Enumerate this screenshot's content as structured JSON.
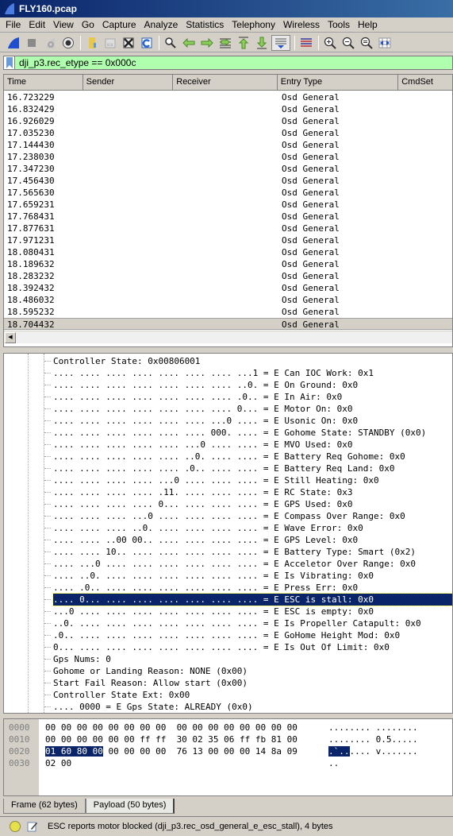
{
  "window": {
    "title": "FLY160.pcap"
  },
  "menu": [
    "File",
    "Edit",
    "View",
    "Go",
    "Capture",
    "Analyze",
    "Statistics",
    "Telephony",
    "Wireless",
    "Tools",
    "Help"
  ],
  "toolbar": {
    "icons": [
      "start-capture-icon",
      "stop-capture-icon",
      "restart-capture-icon",
      "capture-options-icon",
      "open-file-icon",
      "save-file-icon",
      "close-file-icon",
      "reload-file-icon",
      "find-packet-icon",
      "go-back-icon",
      "go-forward-icon",
      "go-to-packet-icon",
      "go-first-icon",
      "go-last-icon",
      "autoscroll-icon",
      "colorize-icon",
      "zoom-in-icon",
      "zoom-out-icon",
      "normal-size-icon",
      "resize-columns-icon"
    ]
  },
  "filter": {
    "value": "dji_p3.rec_etype == 0x000c",
    "placeholder": ""
  },
  "packet_list": {
    "columns": [
      "Time",
      "Sender",
      "Receiver",
      "Entry Type",
      "CmdSet"
    ],
    "rows": [
      {
        "time": "16.723229",
        "sender": "",
        "receiver": "",
        "entry_type": "Osd General",
        "cmdset": ""
      },
      {
        "time": "16.832429",
        "sender": "",
        "receiver": "",
        "entry_type": "Osd General",
        "cmdset": ""
      },
      {
        "time": "16.926029",
        "sender": "",
        "receiver": "",
        "entry_type": "Osd General",
        "cmdset": ""
      },
      {
        "time": "17.035230",
        "sender": "",
        "receiver": "",
        "entry_type": "Osd General",
        "cmdset": ""
      },
      {
        "time": "17.144430",
        "sender": "",
        "receiver": "",
        "entry_type": "Osd General",
        "cmdset": ""
      },
      {
        "time": "17.238030",
        "sender": "",
        "receiver": "",
        "entry_type": "Osd General",
        "cmdset": ""
      },
      {
        "time": "17.347230",
        "sender": "",
        "receiver": "",
        "entry_type": "Osd General",
        "cmdset": ""
      },
      {
        "time": "17.456430",
        "sender": "",
        "receiver": "",
        "entry_type": "Osd General",
        "cmdset": ""
      },
      {
        "time": "17.565630",
        "sender": "",
        "receiver": "",
        "entry_type": "Osd General",
        "cmdset": ""
      },
      {
        "time": "17.659231",
        "sender": "",
        "receiver": "",
        "entry_type": "Osd General",
        "cmdset": ""
      },
      {
        "time": "17.768431",
        "sender": "",
        "receiver": "",
        "entry_type": "Osd General",
        "cmdset": ""
      },
      {
        "time": "17.877631",
        "sender": "",
        "receiver": "",
        "entry_type": "Osd General",
        "cmdset": ""
      },
      {
        "time": "17.971231",
        "sender": "",
        "receiver": "",
        "entry_type": "Osd General",
        "cmdset": ""
      },
      {
        "time": "18.080431",
        "sender": "",
        "receiver": "",
        "entry_type": "Osd General",
        "cmdset": ""
      },
      {
        "time": "18.189632",
        "sender": "",
        "receiver": "",
        "entry_type": "Osd General",
        "cmdset": ""
      },
      {
        "time": "18.283232",
        "sender": "",
        "receiver": "",
        "entry_type": "Osd General",
        "cmdset": ""
      },
      {
        "time": "18.392432",
        "sender": "",
        "receiver": "",
        "entry_type": "Osd General",
        "cmdset": ""
      },
      {
        "time": "18.486032",
        "sender": "",
        "receiver": "",
        "entry_type": "Osd General",
        "cmdset": ""
      },
      {
        "time": "18.595232",
        "sender": "",
        "receiver": "",
        "entry_type": "Osd General",
        "cmdset": ""
      },
      {
        "time": "18.704432",
        "sender": "",
        "receiver": "",
        "entry_type": "Osd General",
        "cmdset": "",
        "selected": true
      }
    ]
  },
  "details": {
    "lines": [
      "Controller State: 0x00806001",
      ".... .... .... .... .... .... .... ...1 = E Can IOC Work: 0x1",
      ".... .... .... .... .... .... .... ..0. = E On Ground: 0x0",
      ".... .... .... .... .... .... .... .0.. = E In Air: 0x0",
      ".... .... .... .... .... .... .... 0... = E Motor On: 0x0",
      ".... .... .... .... .... .... ...0 .... = E Usonic On: 0x0",
      ".... .... .... .... .... .... 000. .... = E Gohome State: STANDBY (0x0)",
      ".... .... .... .... .... ...0 .... .... = E MVO Used: 0x0",
      ".... .... .... .... .... ..0. .... .... = E Battery Req Gohome: 0x0",
      ".... .... .... .... .... .0.. .... .... = E Battery Req Land: 0x0",
      ".... .... .... .... ...0 .... .... .... = E Still Heating: 0x0",
      ".... .... .... .... .11. .... .... .... = E RC State: 0x3",
      ".... .... .... .... 0... .... .... .... = E GPS Used: 0x0",
      ".... .... .... ...0 .... .... .... .... = E Compass Over Range: 0x0",
      ".... .... .... ..0. .... .... .... .... = E Wave Error: 0x0",
      ".... .... ..00 00.. .... .... .... .... = E GPS Level: 0x0",
      ".... .... 10.. .... .... .... .... .... = E Battery Type: Smart (0x2)",
      ".... ...0 .... .... .... .... .... .... = E Acceletor Over Range: 0x0",
      ".... ..0. .... .... .... .... .... .... = E Is Vibrating: 0x0",
      ".... .0.. .... .... .... .... .... .... = E Press Err: 0x0",
      ".... 0... .... .... .... .... .... .... = E ESC is stall: 0x0",
      "...0 .... .... .... .... .... .... .... = E ESC is empty: 0x0",
      "..0. .... .... .... .... .... .... .... = E Is Propeller Catapult: 0x0",
      ".0.. .... .... .... .... .... .... .... = E GoHome Height Mod: 0x0",
      "0... .... .... .... .... .... .... .... = E Is Out Of Limit: 0x0",
      "Gps Nums: 0",
      "Gohome or Landing Reason: NONE (0x00)",
      "Start Fail Reason: Allow start (0x00)",
      "Controller State Ext: 0x00",
      ".... 0000 = E Gps State: ALREADY (0x0)"
    ],
    "selected_index": 20
  },
  "hex": {
    "rows": [
      {
        "offset": "0000",
        "bytes_pre": "",
        "bytes_hl": "",
        "bytes_post": "00 00 00 00 00 00 00 00  00 00 00 00 00 00 00 00",
        "ascii_pre": "",
        "ascii_hl": "",
        "ascii_post": "........ ........"
      },
      {
        "offset": "0010",
        "bytes_pre": "",
        "bytes_hl": "",
        "bytes_post": "00 00 00 00 00 00 ff ff  30 02 35 06 ff fb 81 00",
        "ascii_pre": "",
        "ascii_hl": "",
        "ascii_post": "........ 0.5....."
      },
      {
        "offset": "0020",
        "bytes_pre": "",
        "bytes_hl": "01 60 80 00",
        "bytes_post": " 00 00 00 00  76 13 00 00 00 14 8a 09",
        "ascii_pre": "",
        "ascii_hl": ".`..",
        "ascii_post": ".... v......."
      },
      {
        "offset": "0030",
        "bytes_pre": "",
        "bytes_hl": "",
        "bytes_post": "02 00",
        "ascii_pre": "",
        "ascii_hl": "",
        "ascii_post": ".."
      }
    ]
  },
  "byte_tabs": [
    {
      "label": "Frame (62 bytes)",
      "active": false
    },
    {
      "label": "Payload (50 bytes)",
      "active": true
    }
  ],
  "status": {
    "message": "ESC reports motor blocked (dji_p3.rec_osd_general_e_esc_stall), 4 bytes",
    "indicator_color": "#e6e04a"
  },
  "colors": {
    "filter_valid_bg": "#afffaf",
    "selection_bg": "#0a246a",
    "title_gradient_start": "#0a246a",
    "title_gradient_end": "#3a6ea5"
  }
}
